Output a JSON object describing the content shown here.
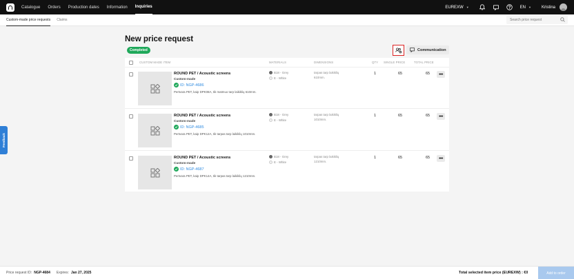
{
  "nav": {
    "items": [
      {
        "label": "Catalogue",
        "active": false
      },
      {
        "label": "Orders",
        "active": false
      },
      {
        "label": "Production dates",
        "active": false
      },
      {
        "label": "Information",
        "active": false
      },
      {
        "label": "Inquiries",
        "active": true
      }
    ],
    "currency": "EUREXW",
    "language": "EN",
    "user_name": "Kristina"
  },
  "subnav": {
    "tabs": [
      {
        "label": "Custom-made price requests",
        "active": true
      },
      {
        "label": "Claims",
        "active": false
      }
    ],
    "search_placeholder": "Search price request"
  },
  "page": {
    "title": "New price request",
    "status": "Completed",
    "communication_label": "Communication"
  },
  "table": {
    "headers": {
      "item": "Custom made item",
      "materials": "Materials",
      "dimensions": "Dimensions",
      "qty": "Qty",
      "single_price": "Single price",
      "total_price": "Total price"
    },
    "rows": [
      {
        "name": "ROUND PET / Acoustic screens",
        "type": "Custom-made",
        "id": "ID: NGP-4686",
        "description": "Pertvara PET, kaip DPK08A, tik matmuo tarp laikiklių 610mm.",
        "material_1": "B18 - Grey",
        "material_2": "E - White",
        "dim_1": "tarpas tarp laikiklių",
        "dim_2": "610mm.",
        "qty": "1",
        "single_price": "65",
        "total_price": "65"
      },
      {
        "name": "ROUND PET / Acoustic screens",
        "type": "Custom-made",
        "id": "ID: NGP-4685",
        "description": "Pertvara PET, kaip DPK12A, tik tarpas tarp laikiklių 1010mm.",
        "material_1": "B18 - Grey",
        "material_2": "E - White",
        "dim_1": "tarpas tarp laikiklių",
        "dim_2": "1010mm.",
        "qty": "1",
        "single_price": "65",
        "total_price": "65"
      },
      {
        "name": "ROUND PET / Acoustic screens",
        "type": "Custom-made",
        "id": "ID: NGP-4687",
        "description": "Pertvara PET, kaip DPK14A, tik tarpas tarp laikiklių 1210mm.",
        "material_1": "B18 - Grey",
        "material_2": "E - White",
        "dim_1": "tarpas tarp laikiklių",
        "dim_2": "1210mm.",
        "qty": "1",
        "single_price": "65",
        "total_price": "65"
      }
    ]
  },
  "feedback_label": "Feedback",
  "footer": {
    "request_id_label": "Price request ID:",
    "request_id": "NGP-4684",
    "expires_label": "Expires:",
    "expires": "Jan 27, 2025",
    "total_label": "Total selected item price (EUREXW) : €0",
    "add_button": "Add to order"
  },
  "colors": {
    "success": "#1fa85a",
    "link": "#2f8be0",
    "nav_bg": "#111111",
    "feedback": "#2f7fd6",
    "highlight": "#dd2222"
  }
}
